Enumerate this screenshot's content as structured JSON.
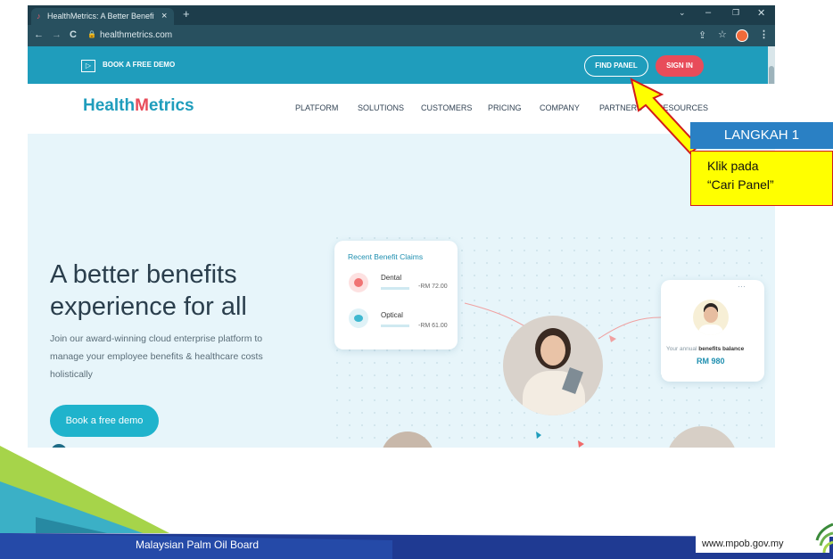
{
  "browser": {
    "tab_title": "HealthMetrics: A Better Benefits |",
    "tab_close": "×",
    "new_tab": "+",
    "url": "healthmetrics.com"
  },
  "site": {
    "topbar": {
      "demo_label": "BOOK A FREE DEMO",
      "find_panel": "FIND PANEL",
      "sign_in": "SIGN IN"
    },
    "logo": {
      "part1": "Health",
      "part2": "etrics"
    },
    "nav": [
      "PLATFORM",
      "SOLUTIONS",
      "CUSTOMERS",
      "PRICING",
      "COMPANY",
      "PARTNERS",
      "RESOURCES"
    ],
    "hero": {
      "title_line1": "A better benefits",
      "title_line2": "experience for all",
      "subtitle_line1": "Join our award-winning cloud enterprise platform to",
      "subtitle_line2": "manage your employee benefits & healthcare costs",
      "subtitle_line3": "holistically",
      "cta": "Book a free demo"
    },
    "claims_card": {
      "title": "Recent Benefit Claims",
      "items": [
        {
          "name": "Dental",
          "amount": "-RM 72.00"
        },
        {
          "name": "Optical",
          "amount": "-RM 61.00"
        }
      ]
    },
    "balance_card": {
      "label_prefix": "Your annual",
      "label_bold": "benefits balance",
      "amount": "RM 980",
      "menu": "···"
    }
  },
  "annotation": {
    "step": "LANGKAH 1",
    "line1": "Klik pada",
    "line2": "“Cari Panel”"
  },
  "footer": {
    "org": "Malaysian Palm Oil Board",
    "url": "www.mpob.gov.my"
  },
  "colors": {
    "accent": "#1f9dbc",
    "sign_in": "#e84c5a",
    "callout_blue": "#2a80c4",
    "callout_yellow": "#ffff00"
  }
}
